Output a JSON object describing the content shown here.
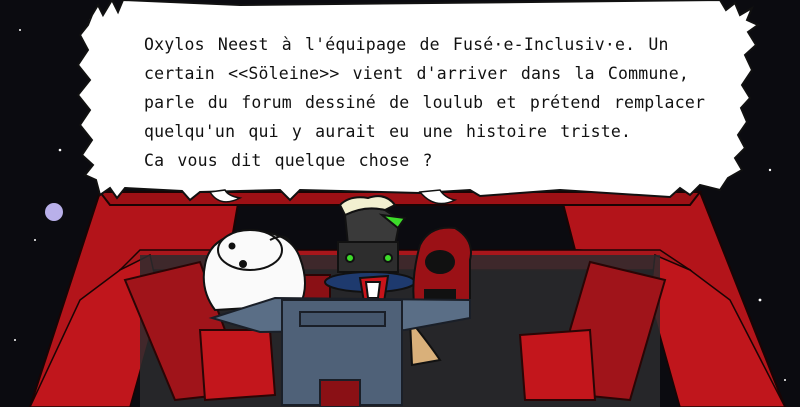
{
  "dialogue": {
    "lines": [
      "Oxylos Neest à l'équipage de Fusé·e-Inclusiv·e. Un",
      "certain <<Söleine>> vient d'arriver dans la Commune,",
      "parle du forum dessiné de loulub et prétend remplacer",
      "quelqu'un qui y aurait eu une histoire triste.",
      "Ca vous dit quelque chose ?"
    ]
  },
  "colors": {
    "space": "#0b0b10",
    "cockpit_red": "#b3141a",
    "console_blue": "#5a6e86",
    "bubble_fill": "#ffffff",
    "alien_green": "#3ddc2a"
  },
  "characters": [
    "polar-bear-character",
    "horned-alien-character",
    "red-hooded-character"
  ]
}
